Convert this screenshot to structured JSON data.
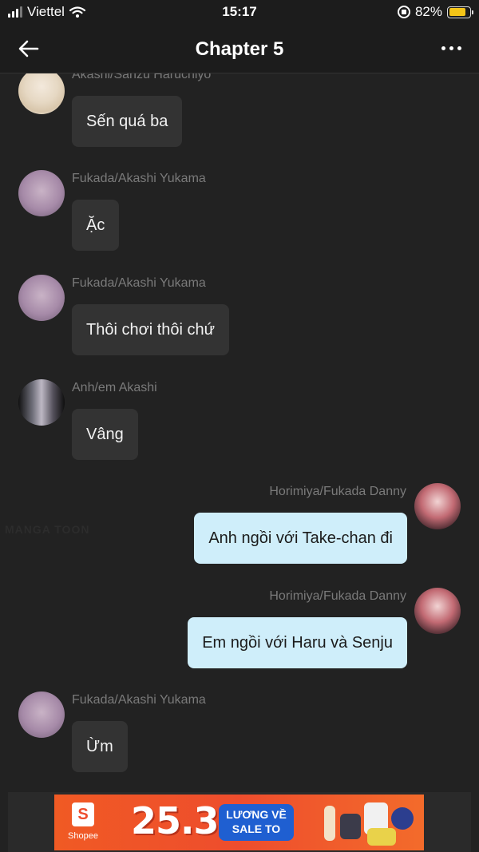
{
  "status_bar": {
    "carrier": "Viettel",
    "time": "15:17",
    "battery_percent": "82%",
    "battery_level": 0.82
  },
  "nav": {
    "title": "Chapter 5",
    "back_icon": "arrow-left-icon",
    "more_icon": "more-horizontal-icon"
  },
  "messages": [
    {
      "side": "left",
      "sender": "Akashi/Sanzu Haruchiyo",
      "text": "Sến quá ba"
    },
    {
      "side": "left",
      "sender": "Fukada/Akashi Yukama",
      "text": "Ặc"
    },
    {
      "side": "left",
      "sender": "Fukada/Akashi Yukama",
      "text": "Thôi chơi thôi chứ"
    },
    {
      "side": "left",
      "sender": "Anh/em Akashi",
      "text": "Vâng"
    },
    {
      "side": "right",
      "sender": "Horimiya/Fukada Danny",
      "text": "Anh ngồi với Take-chan đi"
    },
    {
      "side": "right",
      "sender": "Horimiya/Fukada Danny",
      "text": "Em ngồi với Haru và Senju"
    },
    {
      "side": "left",
      "sender": "Fukada/Akashi Yukama",
      "text": "Ừm"
    }
  ],
  "watermark": "MANGA TOON",
  "ad": {
    "brand": "Shopee",
    "logo_letter": "S",
    "date": "25.3",
    "tag_line1": "LƯƠNG VỀ",
    "tag_line2": "SALE TO"
  },
  "colors": {
    "background": "#222222",
    "bubble_left": "#333333",
    "bubble_right": "#cfeefa",
    "sender_text": "#7a7a7a",
    "battery": "#f5c518",
    "ad_orange": "#ee4d2d",
    "ad_tag_blue": "#1f5fd1"
  }
}
